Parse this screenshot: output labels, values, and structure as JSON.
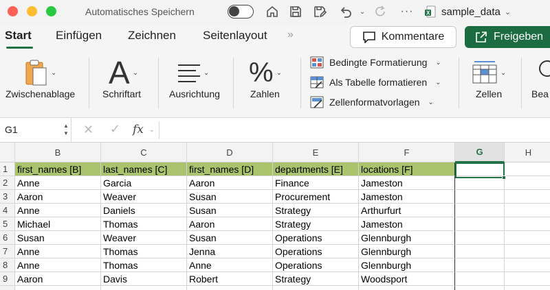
{
  "titlebar": {
    "autosave_label": "Automatisches Speichern",
    "filename": "sample_data"
  },
  "ribbon_tabs": {
    "start": "Start",
    "insert": "Einfügen",
    "draw": "Zeichnen",
    "page_layout": "Seitenlayout",
    "more": "»"
  },
  "actions": {
    "comments": "Kommentare",
    "share": "Freigeben"
  },
  "ribbon": {
    "clipboard": "Zwischenablage",
    "font": "Schriftart",
    "font_glyph": "A",
    "alignment": "Ausrichtung",
    "numbers": "Zahlen",
    "numbers_glyph": "%",
    "conditional_formatting": "Bedingte Formatierung",
    "format_as_table": "Als Tabelle formatieren",
    "cell_styles": "Zellenformatvorlagen",
    "cells": "Zellen",
    "editing_partial": "Bea"
  },
  "formula_bar": {
    "name_box": "G1",
    "cancel": "✕",
    "enter": "✓",
    "fx": "fx",
    "value": ""
  },
  "sheet": {
    "columns": [
      "B",
      "C",
      "D",
      "E",
      "F",
      "G",
      "H"
    ],
    "rows": [
      {
        "num": "1",
        "cells": [
          "first_names [B]",
          "last_names [C]",
          "first_names [D]",
          "departments [E]",
          "locations [F]"
        ]
      },
      {
        "num": "2",
        "cells": [
          "Anne",
          "Garcia",
          "Aaron",
          "Finance",
          "Jameston"
        ]
      },
      {
        "num": "3",
        "cells": [
          "Aaron",
          "Weaver",
          "Susan",
          "Procurement",
          "Jameston"
        ]
      },
      {
        "num": "4",
        "cells": [
          "Anne",
          "Daniels",
          "Susan",
          "Strategy",
          "Arthurfurt"
        ]
      },
      {
        "num": "5",
        "cells": [
          "Michael",
          "Thomas",
          "Aaron",
          "Strategy",
          "Jameston"
        ]
      },
      {
        "num": "6",
        "cells": [
          "Susan",
          "Weaver",
          "Susan",
          "Operations",
          "Glennburgh"
        ]
      },
      {
        "num": "7",
        "cells": [
          "Anne",
          "Thomas",
          "Jenna",
          "Operations",
          "Glennburgh"
        ]
      },
      {
        "num": "8",
        "cells": [
          "Anne",
          "Thomas",
          "Anne",
          "Operations",
          "Glennburgh"
        ]
      },
      {
        "num": "9",
        "cells": [
          "Aaron",
          "Davis",
          "Robert",
          "Strategy",
          "Woodsport"
        ]
      }
    ]
  },
  "colors": {
    "accent": "#217346",
    "header_fill": "#a9c46c",
    "share_button": "#1d6b40"
  }
}
